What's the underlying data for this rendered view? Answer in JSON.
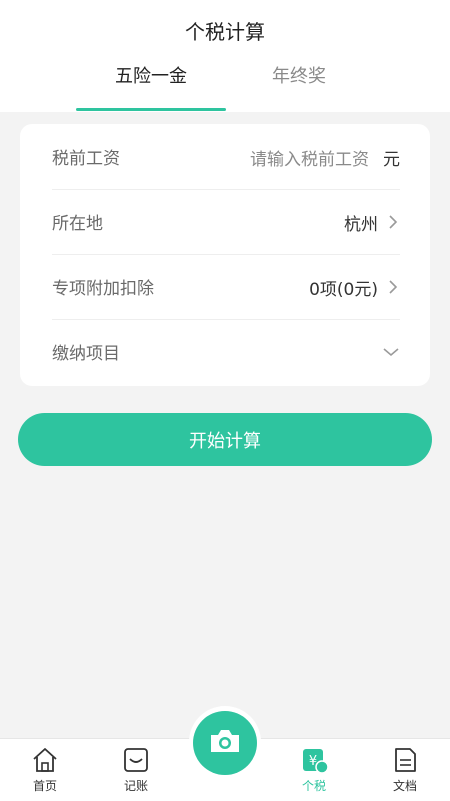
{
  "header": {
    "title": "个税计算"
  },
  "tabs": [
    {
      "label": "五险一金",
      "active": true
    },
    {
      "label": "年终奖",
      "active": false
    }
  ],
  "form": {
    "rows": [
      {
        "label": "税前工资",
        "placeholder": "请输入税前工资",
        "unit": "元"
      },
      {
        "label": "所在地",
        "value": "杭州"
      },
      {
        "label": "专项附加扣除",
        "value": "0项(0元)"
      },
      {
        "label": "缴纳项目"
      }
    ]
  },
  "actions": {
    "calculate_label": "开始计算"
  },
  "tabbar": {
    "items": [
      {
        "label": "首页",
        "icon": "home-icon"
      },
      {
        "label": "记账",
        "icon": "ledger-icon"
      },
      {
        "label": "个税",
        "icon": "tax-icon",
        "active": true
      },
      {
        "label": "文档",
        "icon": "document-icon"
      }
    ],
    "center_icon": "camera-icon"
  },
  "colors": {
    "accent": "#2ec49f",
    "background": "#f3f3f3"
  }
}
